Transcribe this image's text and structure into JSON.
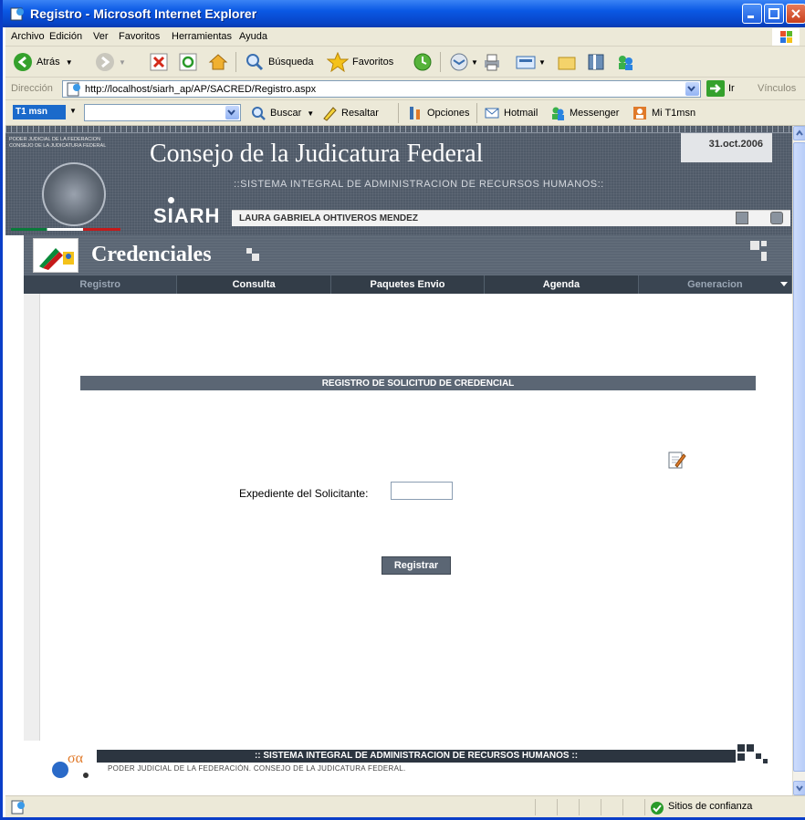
{
  "window": {
    "title": "Registro - Microsoft Internet Explorer"
  },
  "menubar": {
    "items": [
      "Archivo",
      "Edición",
      "Ver",
      "Favoritos",
      "Herramientas",
      "Ayuda"
    ]
  },
  "toolbar": {
    "back_label": "Atrás",
    "search_label": "Búsqueda",
    "favorites_label": "Favoritos"
  },
  "address": {
    "label": "Dirección",
    "url": "http://localhost/siarh_ap/AP/SACRED/Registro.aspx",
    "go_label": "Ir",
    "links_label": "Vínculos"
  },
  "msnbar": {
    "logo": "T1 msn",
    "search_label": "Buscar",
    "highlight_label": "Resaltar",
    "options_label": "Opciones",
    "hotmail_label": "Hotmail",
    "messenger_label": "Messenger",
    "mi_label": "Mi T1msn"
  },
  "header": {
    "org_line1": "PODER JUDICIAL DE LA FEDERACION",
    "org_line2": "CONSEJO DE LA JUDICATURA FEDERAL",
    "title": "Consejo de la Judicatura Federal",
    "subtitle": "::SISTEMA INTEGRAL DE ADMINISTRACION DE RECURSOS HUMANOS::",
    "date": "31.oct.2006",
    "system_logo": "SIARH",
    "user_name": "LAURA GABRIELA OHTIVEROS MENDEZ"
  },
  "module": {
    "title": "Credenciales"
  },
  "nav": {
    "items": [
      "Registro",
      "Consulta",
      "Paquetes Envio",
      "Agenda",
      "Generacion"
    ]
  },
  "form": {
    "section_title": "REGISTRO DE SOLICITUD DE CREDENCIAL",
    "field_label": "Expediente del Solicitante:",
    "field_value": "",
    "submit_label": "Registrar"
  },
  "footer": {
    "bar_text": ":: SISTEMA INTEGRAL DE ADMINISTRACION DE RECURSOS HUMANOS ::",
    "sub_text": "PODER JUDICIAL DE LA FEDERACIÓN. CONSEJO DE LA JUDICATURA FEDERAL."
  },
  "status": {
    "zone": "Sitios de confianza"
  },
  "colors": {
    "titlebar": "#0a58e4",
    "header_bg": "#4f5a68",
    "nav_bg": "#333d48",
    "accent": "#5b6674"
  }
}
